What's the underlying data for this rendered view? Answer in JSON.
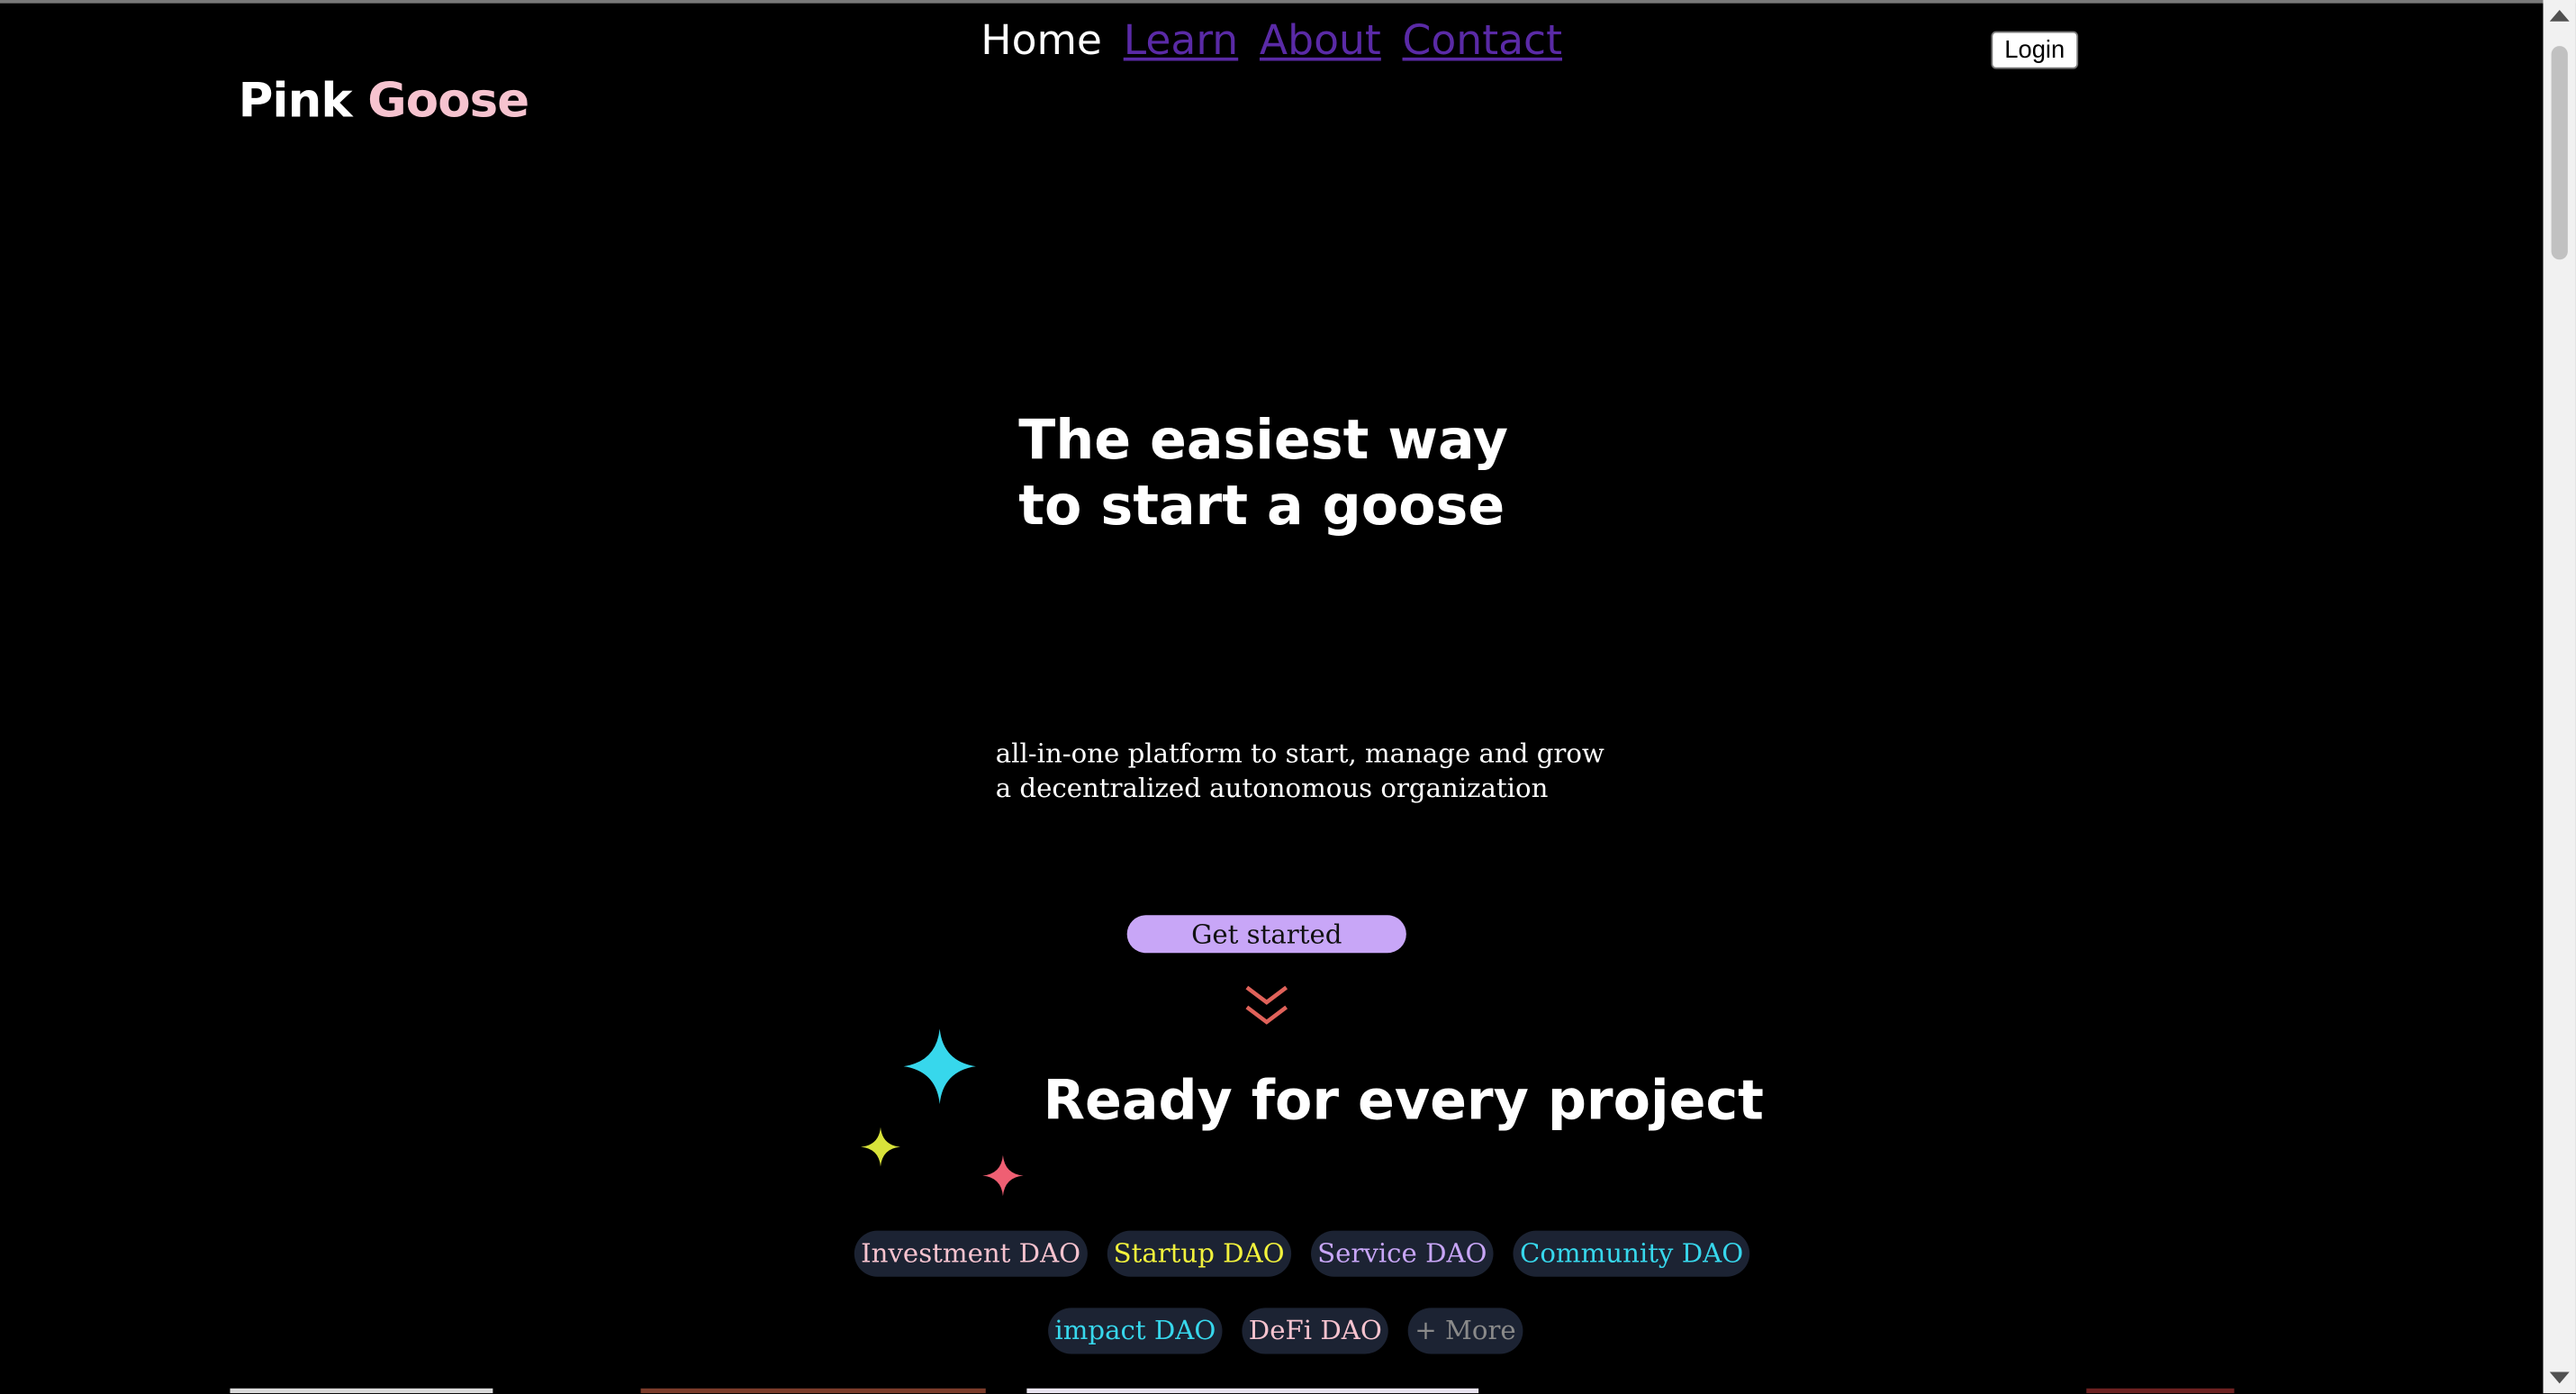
{
  "header": {
    "logo_part1": "Pink",
    "logo_part2": "Goose",
    "logo_accent_color": "#f6c3cf",
    "nav": [
      {
        "label": "Home",
        "active": true
      },
      {
        "label": "Learn",
        "active": false
      },
      {
        "label": "About",
        "active": false
      },
      {
        "label": "Contact",
        "active": false
      }
    ],
    "login_label": "Login"
  },
  "hero": {
    "title_line1": "The easiest way",
    "title_line2": "to start a goose",
    "subtitle_line1": "all-in-one platform to start, manage and grow",
    "subtitle_line2": "a decentralized autonomous organization",
    "cta_label": "Get started",
    "cta_color": "#c8a6f7",
    "scroll_hint_icon": "double-chevron-down-icon"
  },
  "section": {
    "title": "Ready for every project",
    "sparkle_icons": [
      "sparkle-cyan",
      "sparkle-yellow",
      "sparkle-pink"
    ],
    "tags": [
      {
        "label": "Investment DAO",
        "color": "#f6c3cf"
      },
      {
        "label": "Startup DAO",
        "color": "#f2f23c"
      },
      {
        "label": "Service DAO",
        "color": "#c8a6f7"
      },
      {
        "label": "Community DAO",
        "color": "#37d7ec"
      },
      {
        "label": "impact DAO",
        "color": "#37d7ec"
      },
      {
        "label": "DeFi DAO",
        "color": "#f6c3cf"
      },
      {
        "label": "+ More",
        "color": "#8a8a8a"
      }
    ]
  }
}
